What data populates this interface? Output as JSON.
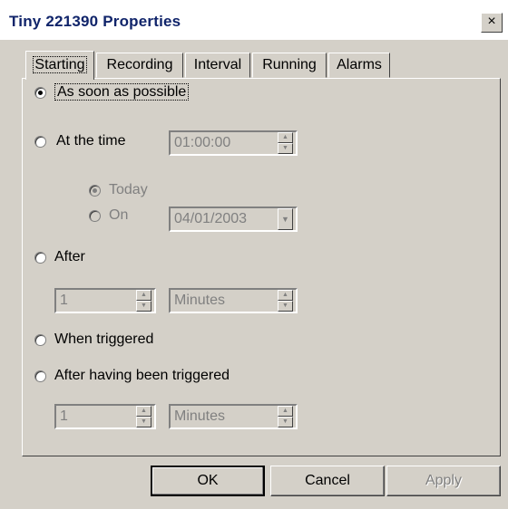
{
  "window": {
    "title": "Tiny 221390 Properties",
    "close_glyph": "×"
  },
  "tabs": [
    {
      "label": "Starting",
      "active": true
    },
    {
      "label": "Recording",
      "active": false
    },
    {
      "label": "Interval",
      "active": false
    },
    {
      "label": "Running",
      "active": false
    },
    {
      "label": "Alarms",
      "active": false
    }
  ],
  "starting": {
    "asap_label": "As soon as possible",
    "at_time_label": "At the time",
    "at_time_value": "01:00:00",
    "today_label": "Today",
    "on_label": "On",
    "on_date_value": "04/01/2003",
    "after_label": "After",
    "after_value": "1",
    "after_unit": "Minutes",
    "when_triggered_label": "When triggered",
    "after_triggered_label": "After having been triggered",
    "after_triggered_value": "1",
    "after_triggered_unit": "Minutes",
    "selected": "As soon as possible",
    "sub_selected": "Today"
  },
  "buttons": {
    "ok": "OK",
    "cancel": "Cancel",
    "apply": "Apply"
  }
}
